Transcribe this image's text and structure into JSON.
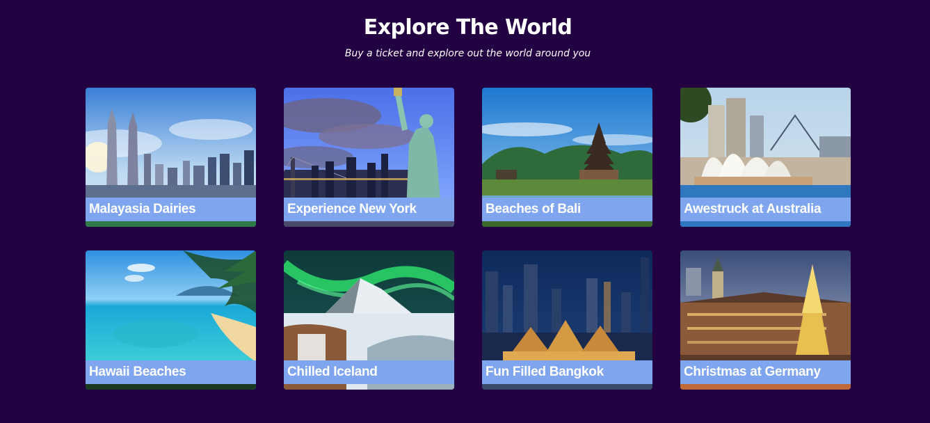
{
  "header": {
    "title": "Explore The World",
    "subtitle": "Buy a ticket and explore out the world around you"
  },
  "accent": {
    "background": "#230042",
    "caption_bar": "#7fa5ee"
  },
  "destinations": [
    {
      "label": "Malayasia Dairies",
      "image": "kuala-lumpur-towers-image"
    },
    {
      "label": "Experience New York",
      "image": "statue-of-liberty-image"
    },
    {
      "label": "Beaches of Bali",
      "image": "bali-temple-image"
    },
    {
      "label": "Awestruck at Australia",
      "image": "sydney-opera-house-image"
    },
    {
      "label": "Hawaii Beaches",
      "image": "hawaii-beach-image"
    },
    {
      "label": "Chilled Iceland",
      "image": "iceland-aurora-image"
    },
    {
      "label": "Fun Filled Bangkok",
      "image": "bangkok-night-image"
    },
    {
      "label": "Christmas at Germany",
      "image": "germany-christmas-image"
    }
  ]
}
